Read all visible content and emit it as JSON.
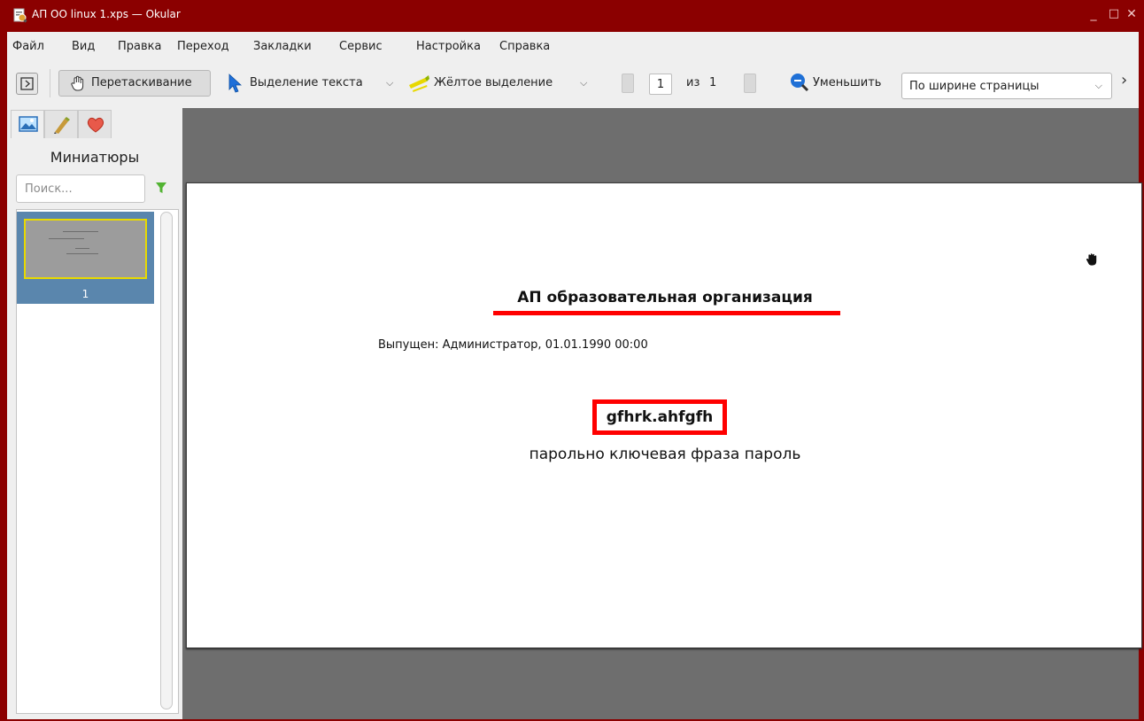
{
  "window": {
    "title": "АП ОО linux 1.xps — Okular",
    "controls": {
      "minimize": "_",
      "maximize": "□",
      "close": "✕"
    },
    "frame_color": "#8b0000"
  },
  "menu": {
    "items": [
      "Файл",
      "Вид",
      "Правка",
      "Переход",
      "Закладки",
      "Сервис",
      "Настройка",
      "Справка"
    ]
  },
  "toolbar": {
    "drag_label": "Перетаскивание",
    "text_select_label": "Выделение текста",
    "highlight_label": "Жёлтое выделение",
    "page_current": "1",
    "page_of": "из",
    "page_total": "1",
    "zoom_out_label": "Уменьшить",
    "zoom_mode": "По ширине страницы",
    "overflow": "›"
  },
  "sidebar": {
    "tabs": [
      "thumbnails-icon",
      "annotations-icon",
      "bookmarks-icon"
    ],
    "title": "Миниатюры",
    "search_placeholder": "Поиск...",
    "thumbnails": [
      {
        "label": "1"
      }
    ]
  },
  "document": {
    "title": "АП образовательная организация",
    "issued": "Выпущен: Администратор, 01.01.1990 00:00",
    "key": "gfhrk.ahfgfh",
    "phrase": "парольно ключевая фраза пароль",
    "highlight_color": "#ff0000"
  }
}
